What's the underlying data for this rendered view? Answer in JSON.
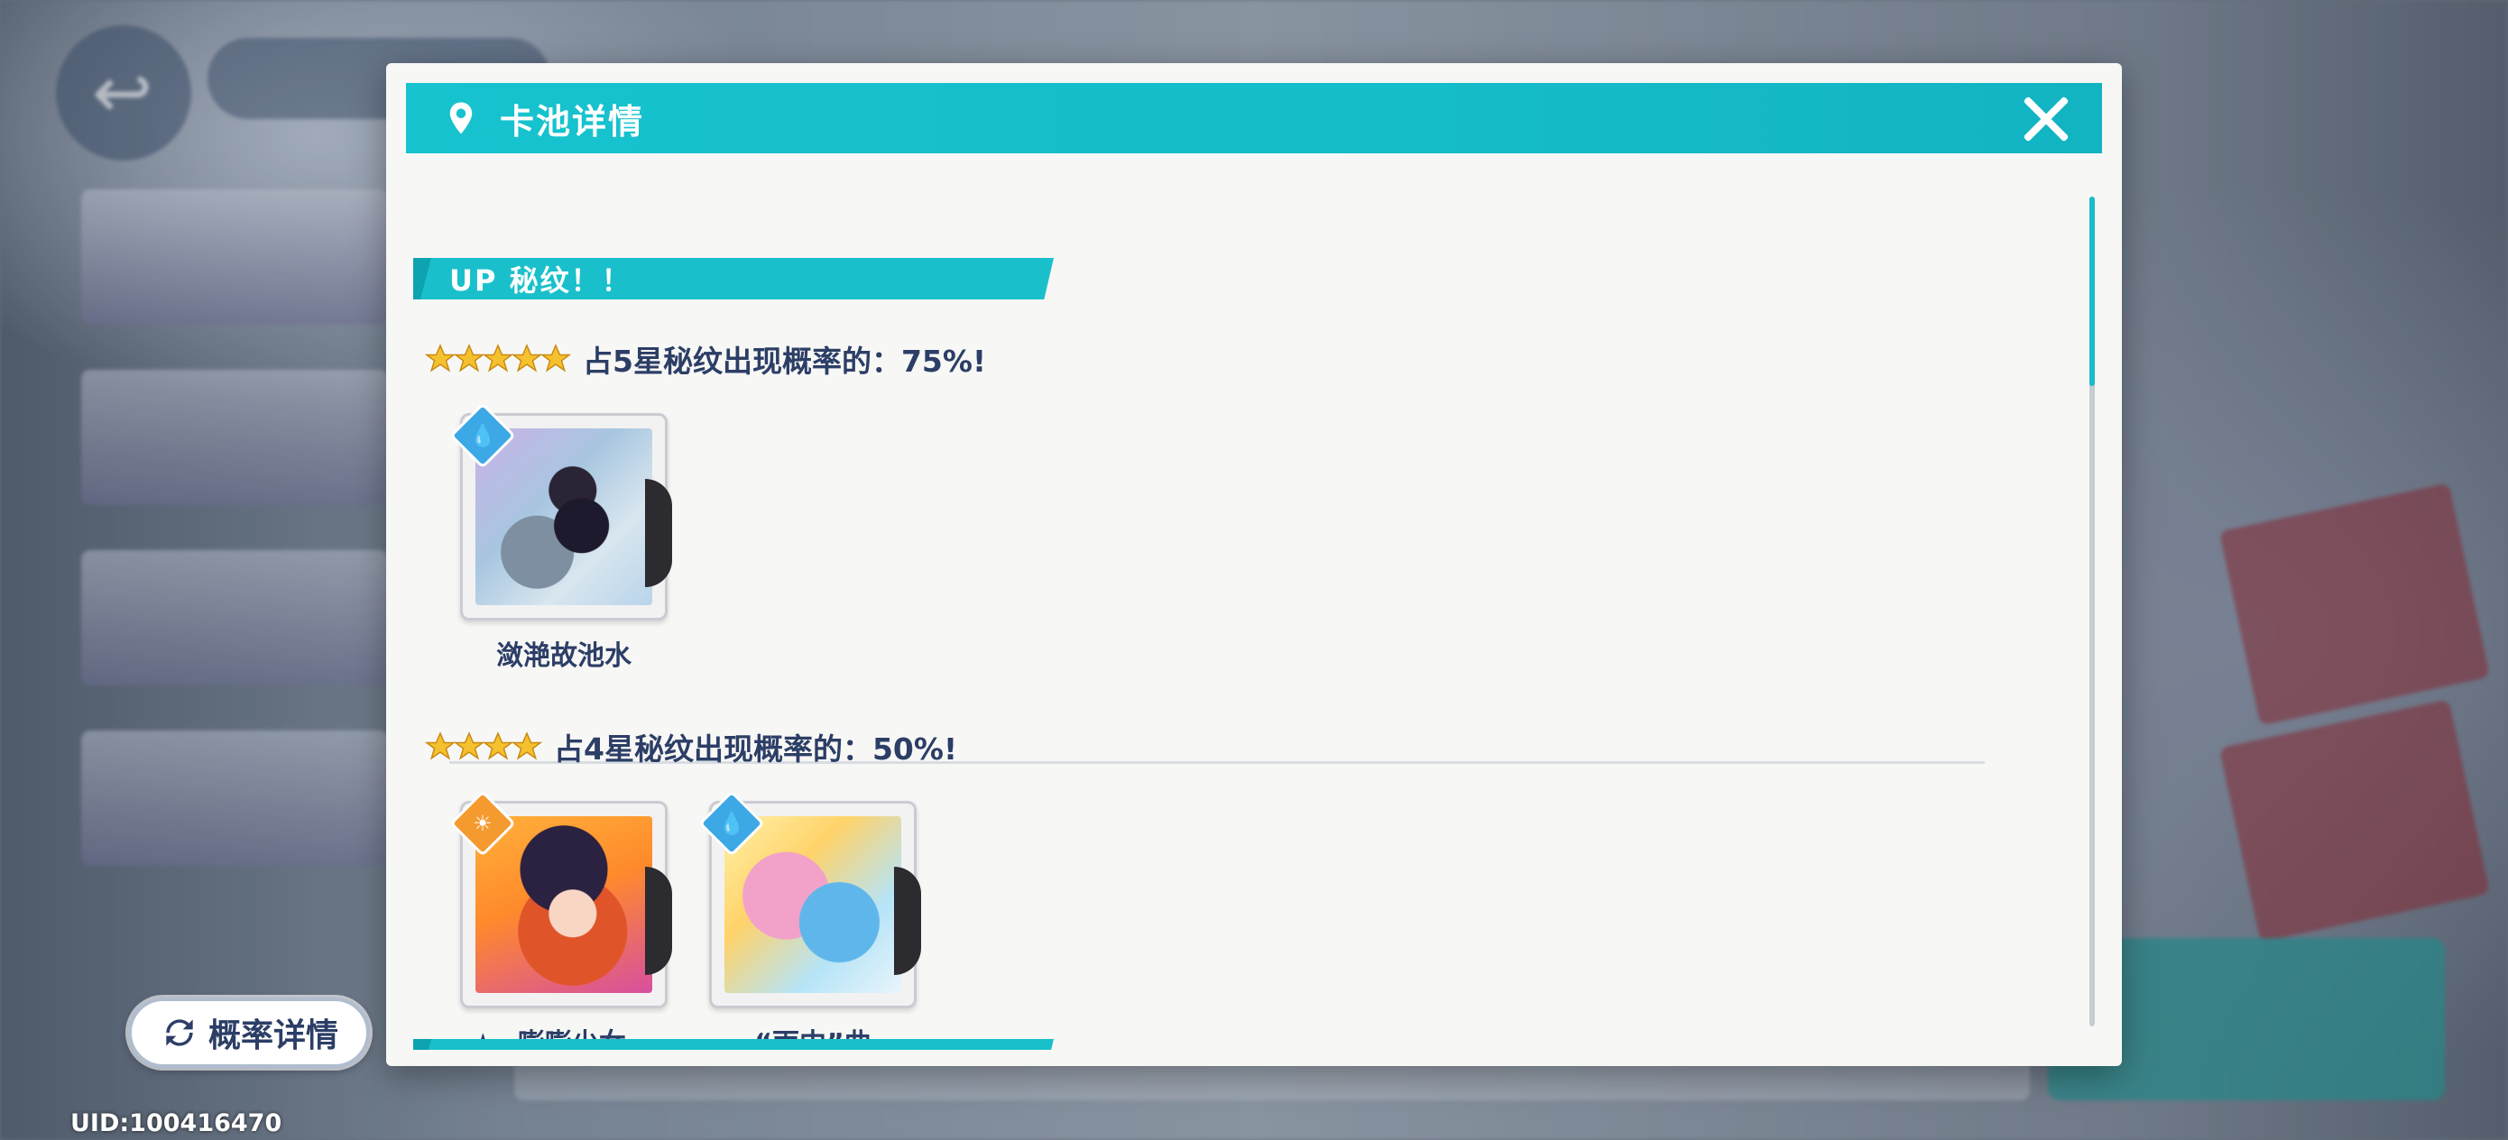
{
  "dialog": {
    "title": "卡池详情",
    "sections": [
      {
        "label": "UP 秘纹！！",
        "groups": [
          {
            "stars": 5,
            "rate_text": "占5星秘纹出现概率的：75%!",
            "cards": [
              {
                "name": "潋滟故池水",
                "element": "water-icon",
                "art_color": "#b9c9e6"
              }
            ]
          },
          {
            "stars": 4,
            "rate_text": "占4星秘纹出现概率的：50%!",
            "cards": [
              {
                "name": "★~嘭嘭少女...",
                "element": "sun-icon",
                "art_color": "#ff9a2e"
              },
              {
                "name": "“雨中”曲",
                "element": "water-icon",
                "art_color": "#ffd36a"
              }
            ]
          }
        ]
      }
    ]
  },
  "probability_button": {
    "label": "概率详情"
  },
  "uid": "UID:100416470",
  "colors": {
    "accent": "#16c3cf",
    "text_primary": "#2c3e66",
    "star_gold": "#f6c12e",
    "water_badge": "#3da8e6",
    "sun_badge": "#f59a2e"
  }
}
